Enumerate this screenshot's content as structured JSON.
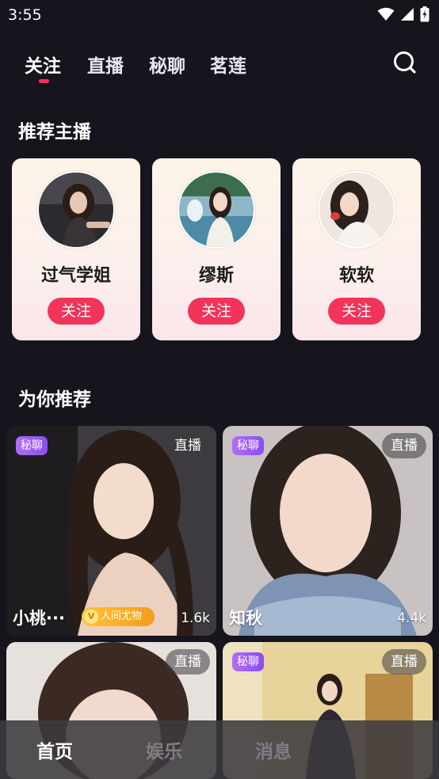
{
  "status_bar": {
    "time": "3:55"
  },
  "top_tabs": [
    {
      "label": "关注",
      "active": true
    },
    {
      "label": "直播",
      "active": false
    },
    {
      "label": "秘聊",
      "active": false
    },
    {
      "label": "茗莲",
      "active": false
    }
  ],
  "icons": {
    "search": "search-icon"
  },
  "sections": {
    "recommended_streamers": "推荐主播",
    "for_you": "为你推荐"
  },
  "streamers": [
    {
      "name": "过气学姐",
      "follow_label": "关注"
    },
    {
      "name": "缪斯",
      "follow_label": "关注"
    },
    {
      "name": "软软",
      "follow_label": "关注"
    }
  ],
  "rooms": [
    {
      "name": "小桃···",
      "private_tag": "秘聊",
      "live_tag": "直播",
      "viewers": "1.6k",
      "badge": "人间尤物",
      "badge_icon": "V"
    },
    {
      "name": "知秋",
      "private_tag": "秘聊",
      "live_tag": "直播",
      "viewers": "4.4k"
    },
    {
      "live_tag": "直播"
    },
    {
      "private_tag": "秘聊",
      "live_tag": "直播"
    }
  ],
  "bottom_nav": [
    {
      "label": "首页",
      "active": true
    },
    {
      "label": "娱乐",
      "active": false
    },
    {
      "label": "消息",
      "active": false
    }
  ],
  "colors": {
    "accent": "#f2345b",
    "background": "#16141d",
    "private_tag": "#9b5cf4",
    "badge": "#f7a823"
  }
}
